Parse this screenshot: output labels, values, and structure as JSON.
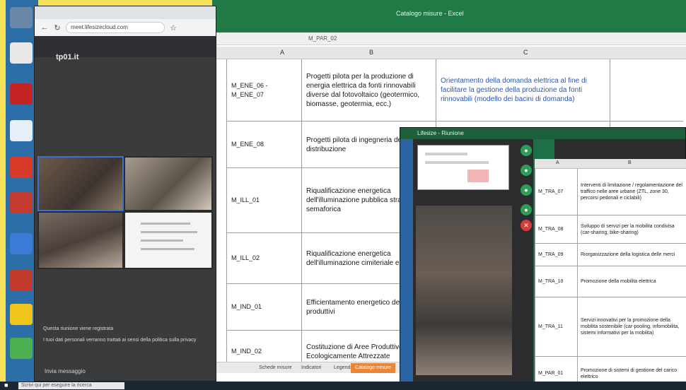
{
  "browser": {
    "url": "meet.lifesizecloud.com",
    "meeting_name": "tp01.it"
  },
  "meeting": {
    "chat_notice_title": "Questa riunione viene registrata",
    "chat_notice_body": "I tuoi dati personali verranno trattati ai sensi della politica sulla privacy",
    "chat_placeholder": "Invia messaggio"
  },
  "sheet": {
    "title": "Catalogo misure - Excel",
    "formula": "M_PAR_02",
    "columns": [
      "A",
      "B",
      "C"
    ],
    "rows": [
      {
        "code": "M_ENE_06 - M_ENE_07",
        "desc": "Progetti pilota per la produzione di energia elettrica da fonti rinnovabili diverse dal fotovoltaico (geotermico, biomasse, geotermia, ecc.)",
        "obj": "Orientamento della domanda elettrica al fine di facilitare la gestione della produzione da fonti rinnovabili (modello dei bacini di domanda)"
      },
      {
        "code": "M_ENE_08",
        "desc": "Progetti pilota di ingegneria delle reti di distribuzione",
        "obj": ""
      },
      {
        "code": "M_ILL_01",
        "desc": "Riqualificazione energetica dell'illuminazione pubblica stradale e semaforica",
        "obj": ""
      },
      {
        "code": "M_ILL_02",
        "desc": "Riqualificazione energetica dell'illuminazione cimiteriale e votiva",
        "obj": ""
      },
      {
        "code": "M_IND_01",
        "desc": "Efficientamento energetico dei processi produttivi",
        "obj": ""
      },
      {
        "code": "M_IND_02",
        "desc": "Costituzione di Aree Produttive Ecologicamente Attrezzate",
        "obj": ""
      }
    ],
    "tabs": [
      "Schede misure",
      "Indicatori",
      "Legenda",
      "Catalogo misure"
    ]
  },
  "front": {
    "title": "Lifesize - Riunione",
    "columns": [
      "A",
      "B"
    ],
    "rows": [
      {
        "code": "M_TRA_07",
        "desc": "Interventi di limitazione / regolamentazione del traffico nelle aree urbane (ZTL, zone 30, percorsi pedonali e ciclabili)"
      },
      {
        "code": "M_TRA_08",
        "desc": "Sviluppo di servizi per la mobilita condivisa (car-sharing, bike-sharing)"
      },
      {
        "code": "M_TRA_09",
        "desc": "Riorganizzazione della logistica delle merci"
      },
      {
        "code": "M_TRA_10",
        "desc": "Promozione della mobilita elettrica"
      },
      {
        "code": "M_TRA_11",
        "desc": "Servizi innovativi per la promozione della mobilita sostenibile (car-pooling, infomobilita, sistemi informativi per la mobilita)"
      },
      {
        "code": "M_PAR_01",
        "desc": "Promozione di sistemi di gestione del carico elettrico"
      }
    ]
  },
  "taskbar": {
    "search_placeholder": "Scrivi qui per eseguire la ricerca"
  },
  "colors": {
    "excel_green": "#1f7a45",
    "desktop_border": "#f5e05a",
    "leave_red": "#d93b3b",
    "control_green": "#2e9b57"
  }
}
